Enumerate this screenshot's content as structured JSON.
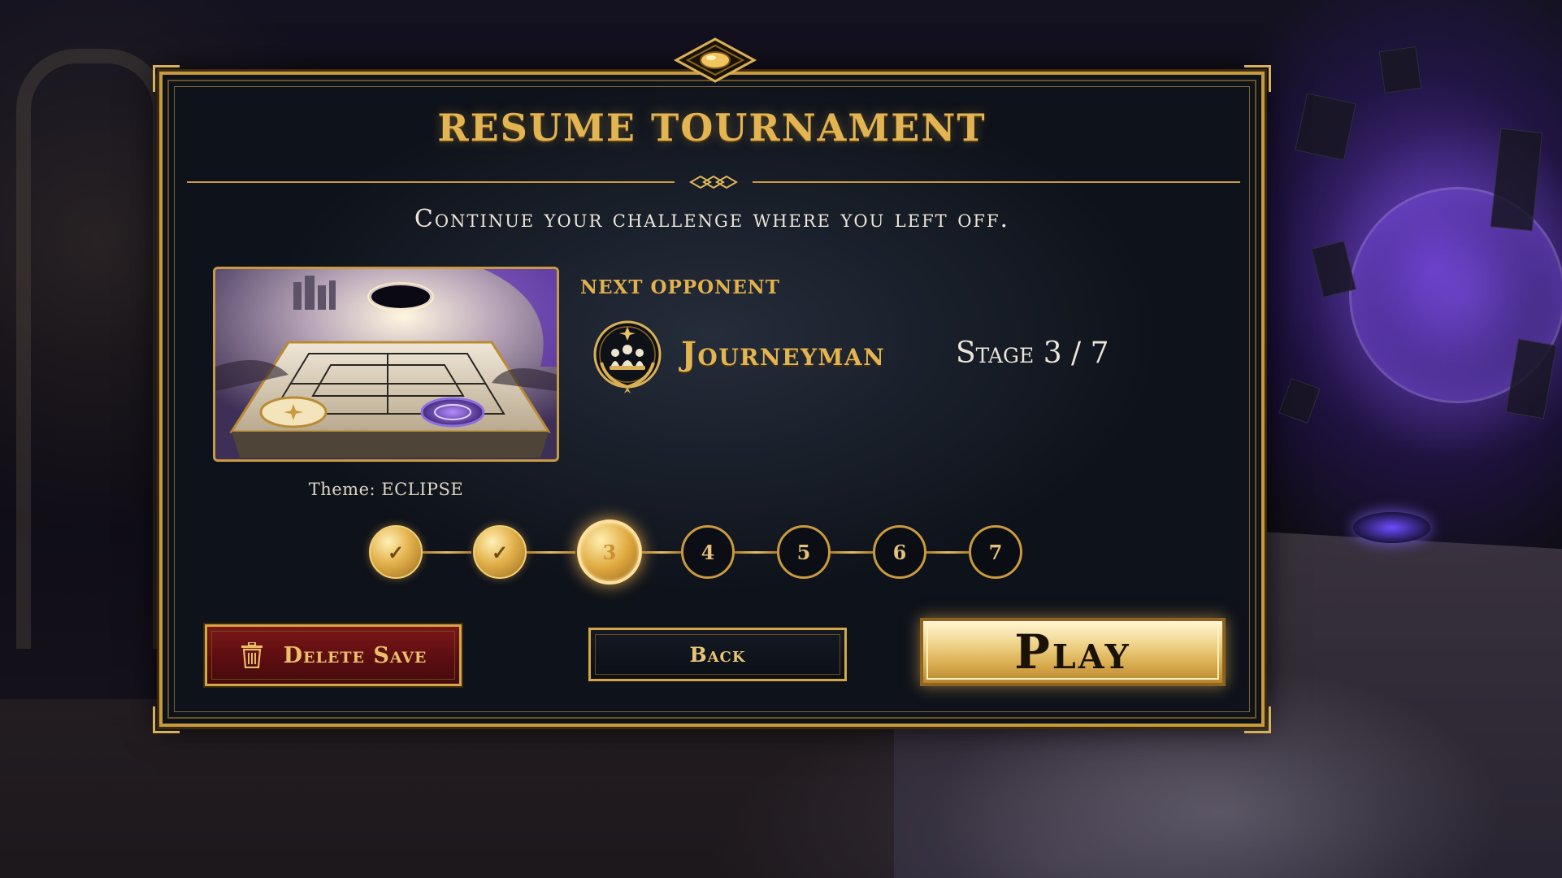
{
  "dialog": {
    "title": "RESUME TOURNAMENT",
    "subtitle": "Continue your challenge where you left off."
  },
  "preview": {
    "theme_label": "Theme: ECLIPSE"
  },
  "opponent": {
    "section_label": "NEXT OPPONENT",
    "name": "Journeyman",
    "stage_text": "Stage 3 / 7",
    "emblem_icon": "pawn-trio-laurel-icon"
  },
  "progress": {
    "current_stage": 3,
    "total_stages": 7,
    "nodes": [
      {
        "label": "✓",
        "state": "done"
      },
      {
        "label": "✓",
        "state": "done"
      },
      {
        "label": "3",
        "state": "current"
      },
      {
        "label": "4",
        "state": "locked"
      },
      {
        "label": "5",
        "state": "locked"
      },
      {
        "label": "6",
        "state": "locked"
      },
      {
        "label": "7",
        "state": "locked"
      }
    ]
  },
  "buttons": {
    "delete_label": "Delete Save",
    "delete_icon": "trash-icon",
    "back_label": "Back",
    "play_label": "Play"
  },
  "colors": {
    "gold": "#e3b552",
    "panel": "#0d1119",
    "delete_red": "#7c1719"
  }
}
